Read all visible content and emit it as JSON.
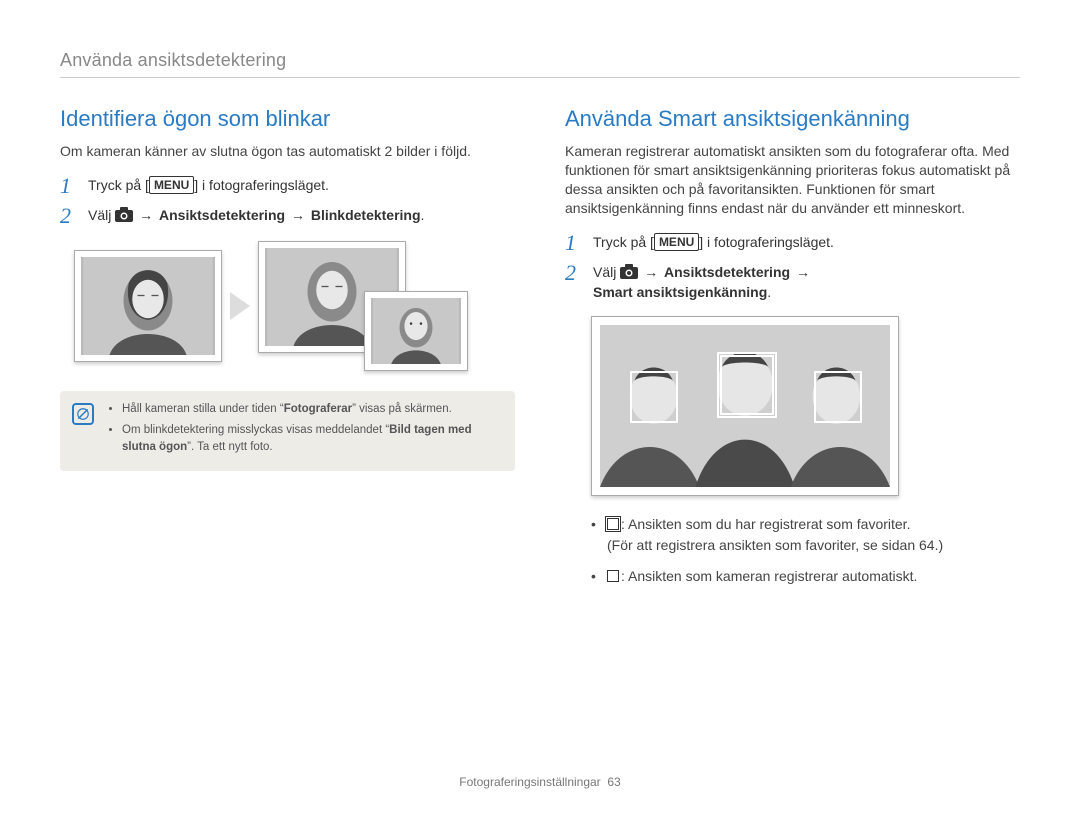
{
  "header": {
    "title": "Använda ansiktsdetektering"
  },
  "left": {
    "title": "Identifiera ögon som blinkar",
    "intro": "Om kameran känner av slutna ögon tas automatiskt 2 bilder i följd.",
    "step1_a": "Tryck på [",
    "step1_menu": "MENU",
    "step1_b": "] i fotograferingsläget.",
    "step2_a": "Välj ",
    "step2_arrow": " → ",
    "step2_b": "Ansiktsdetektering",
    "step2_c": "Blinkdetektering",
    "note1_a": "Håll kameran stilla under tiden “",
    "note1_b": "Fotograferar",
    "note1_c": "” visas på skärmen.",
    "note2_a": "Om blinkdetektering misslyckas visas meddelandet “",
    "note2_b": "Bild tagen med slutna ögon",
    "note2_c": "”. Ta ett nytt foto."
  },
  "right": {
    "title": "Använda Smart ansiktsigenkänning",
    "intro": "Kameran registrerar automatiskt ansikten som du fotograferar ofta. Med funktionen för smart ansiktsigenkänning prioriteras fokus automatiskt på dessa ansikten och på favoritansikten. Funktionen för smart ansiktsigenkänning finns endast när du använder ett minneskort.",
    "step1_a": "Tryck på [",
    "step1_menu": "MENU",
    "step1_b": "] i fotograferingsläget.",
    "step2_a": "Välj ",
    "step2_arrow": " → ",
    "step2_b": "Ansiktsdetektering",
    "step2_c": "Smart ansiktsigenkänning",
    "legend1_a": ": Ansikten som du har registrerat som favoriter.",
    "legend1_b": "(För att registrera ansikten som favoriter, se sidan 64.)",
    "legend2": ": Ansikten som kameran registrerar automatiskt."
  },
  "footer": {
    "section": "Fotograferingsinställningar",
    "page": "63"
  }
}
